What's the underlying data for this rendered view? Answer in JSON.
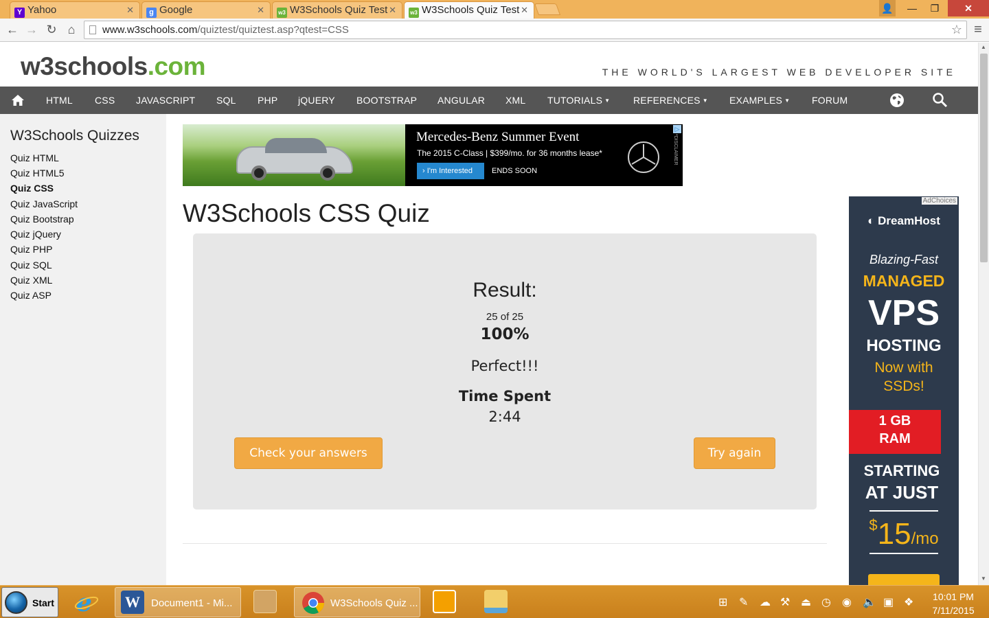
{
  "browser": {
    "tabs": [
      {
        "label": "Yahoo",
        "favicon": "Y"
      },
      {
        "label": "Google",
        "favicon": "g"
      },
      {
        "label": "W3Schools Quiz Test",
        "favicon": "w3"
      },
      {
        "label": "W3Schools Quiz Test",
        "favicon": "w3"
      }
    ],
    "url_host": "www.w3schools.com",
    "url_path": "/quiztest/quiztest.asp?qtest=CSS"
  },
  "site": {
    "logo_main": "w3schools",
    "logo_tld": ".com",
    "tagline": "THE WORLD'S LARGEST WEB DEVELOPER SITE"
  },
  "nav": {
    "items": [
      "HTML",
      "CSS",
      "JAVASCRIPT",
      "SQL",
      "PHP",
      "jQUERY",
      "BOOTSTRAP",
      "ANGULAR",
      "XML",
      "TUTORIALS",
      "REFERENCES",
      "EXAMPLES",
      "FORUM"
    ]
  },
  "sidebar": {
    "title": "W3Schools Quizzes",
    "links": [
      "Quiz HTML",
      "Quiz HTML5",
      "Quiz CSS",
      "Quiz JavaScript",
      "Quiz Bootstrap",
      "Quiz jQuery",
      "Quiz PHP",
      "Quiz SQL",
      "Quiz XML",
      "Quiz ASP"
    ],
    "active_index": 2
  },
  "ad_top": {
    "headline": "Mercedes-Benz Summer Event",
    "subline": "The 2015 C-Class | $399/mo. for 36 months lease*",
    "button": "I'm Interested",
    "ends": "ENDS SOON",
    "disclaimer": "*DISCLAIMER"
  },
  "main": {
    "title": "W3Schools CSS Quiz",
    "result_label": "Result:",
    "score": "25 of 25",
    "percent": "100%",
    "verdict": "Perfect!!!",
    "time_label": "Time Spent",
    "time_value": "2:44",
    "check_button": "Check your answers",
    "retry_button": "Try again"
  },
  "ad_side": {
    "adchoices": "AdChoices",
    "brand": "DreamHost",
    "line1": "Blazing-Fast",
    "line2": "MANAGED",
    "line3": "VPS",
    "line4": "HOSTING",
    "line5a": "Now with",
    "line5b": "SSDs!",
    "ram1": "1 GB",
    "ram2": "RAM",
    "starting1": "STARTING",
    "starting2": "AT JUST",
    "price_sup": "$",
    "price": "15",
    "price_unit": "/mo"
  },
  "taskbar": {
    "start": "Start",
    "word_task": "Document1 - Mi...",
    "chrome_task": "W3Schools Quiz ...",
    "time": "10:01 PM",
    "date": "7/11/2015"
  },
  "colors": {
    "nav_bg": "#555555",
    "accent_green": "#6bb33a",
    "button_orange": "#f1a944",
    "sidebar_bg": "#f1f1f1",
    "quizbox_bg": "#e7e7e7"
  }
}
